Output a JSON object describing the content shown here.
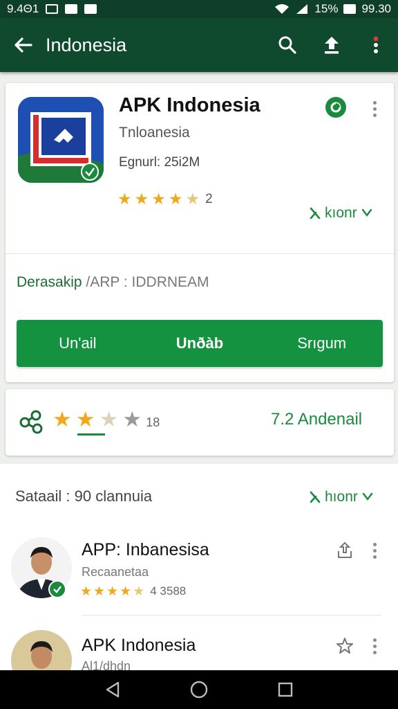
{
  "status_bar": {
    "left_text": "9.4Θ1",
    "battery": "15%",
    "time": "99.30"
  },
  "app_bar": {
    "title": "Indonesia",
    "icons": [
      "back-arrow-icon",
      "search-icon",
      "share-upload-icon",
      "overflow-menu-icon"
    ]
  },
  "app_card": {
    "name": "APK Indonesia",
    "developer": "Tnloanesia",
    "size": "Egnurl: 25i2M",
    "rating_count": "2",
    "rating_stars": 4.5,
    "more_link": "kıonr",
    "desc_label": "Derasakip",
    "desc_value": "/ARP : IDDRNEAM",
    "buttons": [
      "Un'ail",
      "Unðàb",
      "Srıgum"
    ],
    "colors": {
      "accent": "#15923f",
      "app_bar": "#0f4a2e"
    }
  },
  "rate_card": {
    "stars_value": 2,
    "count_label": "18",
    "link_text": "7.2 Andenail"
  },
  "section": {
    "title": "Sataail : 90 clannuia",
    "more_link": "hıonr",
    "items": [
      {
        "name": "APP: Inbanesisa",
        "subtitle": "Recaanetaa",
        "rating_count": "4 3588",
        "rating_stars": 4.5,
        "action_icon": "upload-icon"
      },
      {
        "name": "APK Indonesia",
        "subtitle": "Al1/dhdn",
        "action_icon": "star-outline-icon"
      }
    ]
  }
}
